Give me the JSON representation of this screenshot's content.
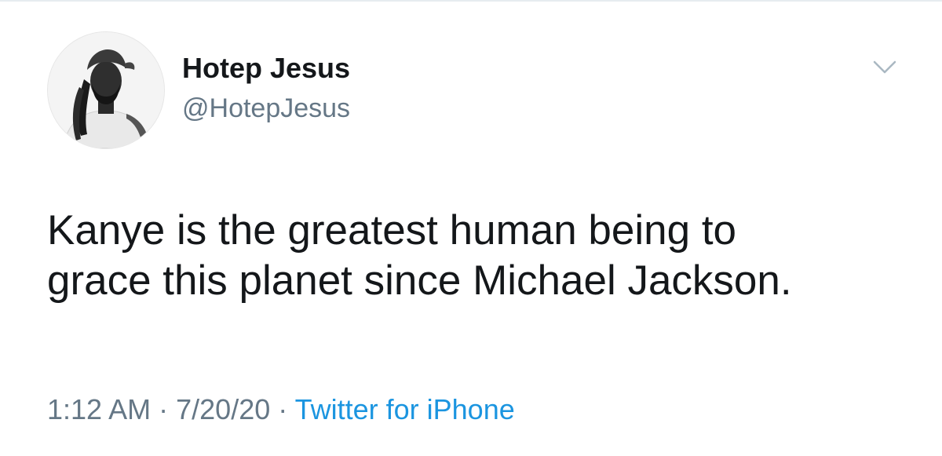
{
  "tweet": {
    "author": {
      "display_name": "Hotep Jesus",
      "handle": "@HotepJesus",
      "avatar_icon": "profile-photo"
    },
    "text_lines": [
      "Kanye is the greatest human being to",
      "grace this planet since Michael Jackson."
    ],
    "meta": {
      "time": "1:12 AM",
      "separator": "·",
      "date": "7/20/20",
      "source": "Twitter for iPhone"
    },
    "menu_icon": "chevron-down-icon"
  },
  "colors": {
    "text": "#14171a",
    "secondary": "#657786",
    "link": "#1b95e0",
    "border": "#e6ecf0"
  }
}
